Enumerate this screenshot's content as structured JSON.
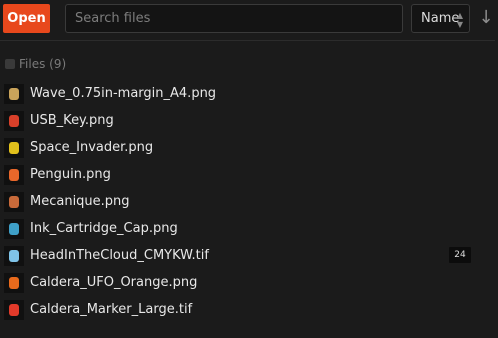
{
  "toolbar": {
    "open_label": "Open",
    "search_placeholder": "Search files",
    "search_value": "",
    "sort_value": "Name",
    "sort_order_icon": "arrow-down-icon"
  },
  "files_header": {
    "label": "Files (9)"
  },
  "files": [
    {
      "name": "Wave_0.75in-margin_A4.png",
      "thumb_icon": "image-thumbnail-icon",
      "thumb_color": "#c9a35a"
    },
    {
      "name": "USB_Key.png",
      "thumb_icon": "image-thumbnail-icon",
      "thumb_color": "#d8402a"
    },
    {
      "name": "Space_Invader.png",
      "thumb_icon": "image-thumbnail-icon",
      "thumb_color": "#e2c11c"
    },
    {
      "name": "Penguin.png",
      "thumb_icon": "image-thumbnail-icon",
      "thumb_color": "#e8672a"
    },
    {
      "name": "Mecanique.png",
      "thumb_icon": "image-thumbnail-icon",
      "thumb_color": "#c86a3a"
    },
    {
      "name": "Ink_Cartridge_Cap.png",
      "thumb_icon": "image-thumbnail-icon",
      "thumb_color": "#3fa0c8"
    },
    {
      "name": "HeadInTheCloud_CMYKW.tif",
      "thumb_icon": "image-thumbnail-icon",
      "thumb_color": "#7fc3e8",
      "badge": "24"
    },
    {
      "name": "Caldera_UFO_Orange.png",
      "thumb_icon": "image-thumbnail-icon",
      "thumb_color": "#e86a1c"
    },
    {
      "name": "Caldera_Marker_Large.tif",
      "thumb_icon": "image-thumbnail-icon",
      "thumb_color": "#e23a2a"
    }
  ]
}
